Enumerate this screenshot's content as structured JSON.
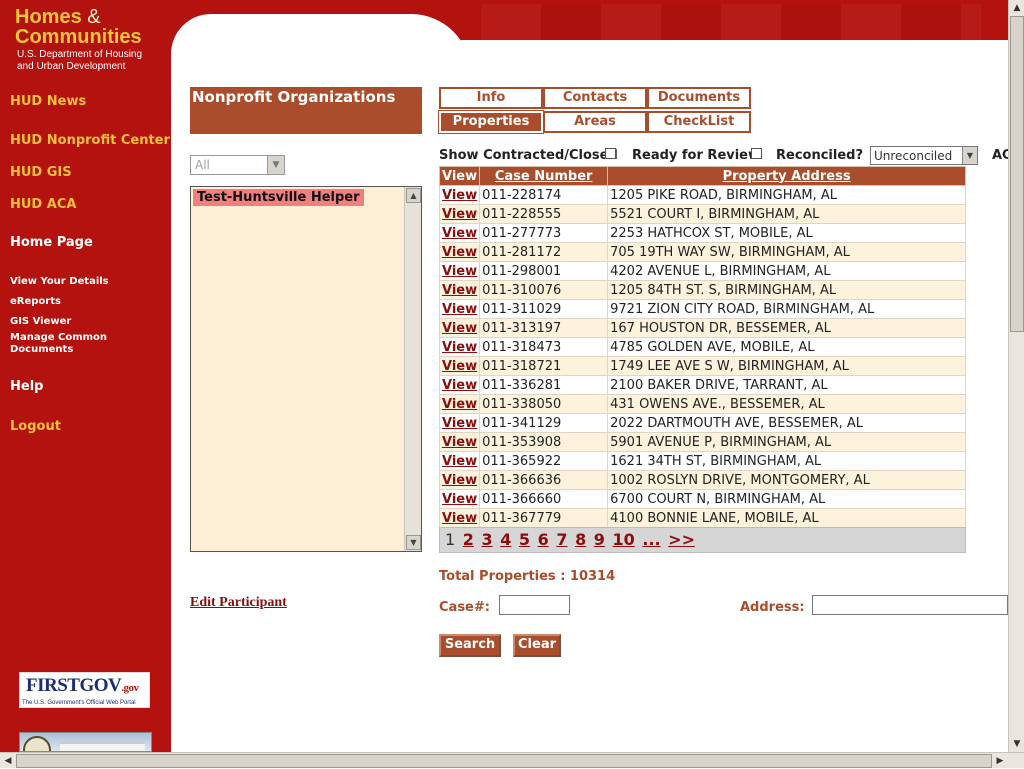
{
  "logo": {
    "line1": "Homes",
    "amp": "&",
    "line2": "Communities",
    "sub1": "U.S. Department of Housing",
    "sub2": "and Urban Development"
  },
  "sidebar": {
    "links": [
      {
        "label": "HUD News"
      },
      {
        "label": "HUD Nonprofit Center"
      },
      {
        "label": "HUD GIS"
      },
      {
        "label": "HUD ACA"
      },
      {
        "label": "Home Page"
      },
      {
        "label": "View Your Details"
      },
      {
        "label": "eReports"
      },
      {
        "label": "GIS Viewer"
      },
      {
        "label": "Manage Common"
      },
      {
        "label": "Documents"
      },
      {
        "label": "Help"
      },
      {
        "label": "Logout"
      }
    ],
    "firstgov": {
      "main": "FIRSTGOV",
      "gov": ".gov",
      "tagline": "The U.S. Government's Official Web Portal"
    }
  },
  "nonprofit": {
    "title": "Nonprofit Organizations",
    "filter_value": "All",
    "selected_item": "Test-Huntsville Helper",
    "edit_link": "Edit Participant"
  },
  "tabs": [
    "Info",
    "Contacts",
    "Documents",
    "Properties",
    "Areas",
    "CheckList"
  ],
  "filters": {
    "show_contracted": "Show Contracted/Closed",
    "ready_for_review": "Ready for Review",
    "reconciled": "Reconciled?",
    "reconciled_value": "Unreconciled",
    "extra": "AC"
  },
  "table": {
    "headers": {
      "view": "View",
      "case": "Case Number",
      "address": "Property Address"
    },
    "rows": [
      {
        "view": "View",
        "case": "011-228174",
        "address": "1205 PIKE ROAD, BIRMINGHAM, AL"
      },
      {
        "view": "View",
        "case": "011-228555",
        "address": "5521 COURT I, BIRMINGHAM, AL"
      },
      {
        "view": "View",
        "case": "011-277773",
        "address": "2253 HATHCOX ST, MOBILE, AL"
      },
      {
        "view": "View",
        "case": "011-281172",
        "address": "705 19TH WAY SW, BIRMINGHAM, AL"
      },
      {
        "view": "View",
        "case": "011-298001",
        "address": "4202 AVENUE L, BIRMINGHAM, AL"
      },
      {
        "view": "View",
        "case": "011-310076",
        "address": "1205 84TH ST. S, BIRMINGHAM, AL"
      },
      {
        "view": "View",
        "case": "011-311029",
        "address": "9721 ZION CITY ROAD, BIRMINGHAM, AL"
      },
      {
        "view": "View",
        "case": "011-313197",
        "address": "167 HOUSTON DR, BESSEMER, AL"
      },
      {
        "view": "View",
        "case": "011-318473",
        "address": "4785 GOLDEN AVE, MOBILE, AL"
      },
      {
        "view": "View",
        "case": "011-318721",
        "address": "1749 LEE AVE S W, BIRMINGHAM, AL"
      },
      {
        "view": "View",
        "case": "011-336281",
        "address": "2100 BAKER DRIVE, TARRANT, AL"
      },
      {
        "view": "View",
        "case": "011-338050",
        "address": "431 OWENS AVE., BESSEMER, AL"
      },
      {
        "view": "View",
        "case": "011-341129",
        "address": "2022 DARTMOUTH AVE, BESSEMER, AL"
      },
      {
        "view": "View",
        "case": "011-353908",
        "address": "5901 AVENUE P, BIRMINGHAM, AL"
      },
      {
        "view": "View",
        "case": "011-365922",
        "address": "1621 34TH ST, BIRMINGHAM, AL"
      },
      {
        "view": "View",
        "case": "011-366636",
        "address": "1002 ROSLYN DRIVE, MONTGOMERY, AL"
      },
      {
        "view": "View",
        "case": "011-366660",
        "address": "6700 COURT N, BIRMINGHAM, AL"
      },
      {
        "view": "View",
        "case": "011-367779",
        "address": "4100 BONNIE LANE, MOBILE, AL"
      }
    ]
  },
  "pager": {
    "current": "1",
    "pages": [
      "2",
      "3",
      "4",
      "5",
      "6",
      "7",
      "8",
      "9",
      "10",
      "...",
      ">>"
    ]
  },
  "search": {
    "total": "Total Properties : 10314",
    "case_label": "Case#:",
    "case_value": "",
    "address_label": "Address:",
    "address_value": "",
    "search_button": "Search",
    "clear_button": "Clear"
  },
  "colors": {
    "brand_red": "#b3120f",
    "accent_brown": "#a94d2c",
    "nav_yellow": "#f6c13a"
  }
}
